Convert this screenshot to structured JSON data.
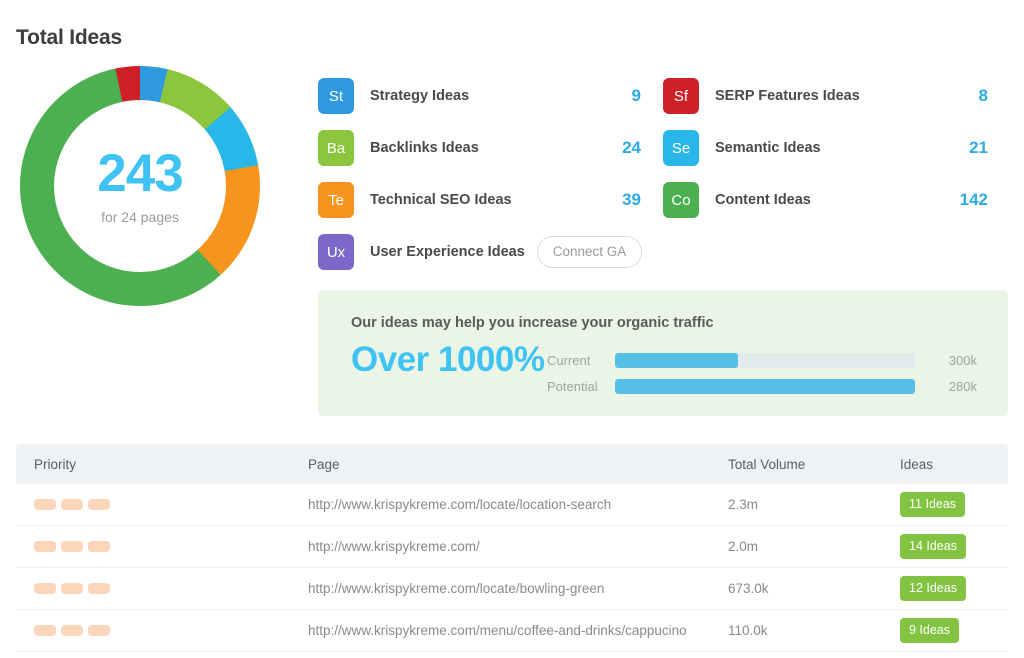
{
  "page_title": "Total Ideas",
  "donut": {
    "total": "243",
    "subtitle": "for 24 pages"
  },
  "chart_data": {
    "type": "pie",
    "title": "Total Ideas",
    "center_value": 243,
    "center_label": "for 24 pages",
    "categories": [
      "Strategy Ideas",
      "Backlinks Ideas",
      "Semantic Ideas",
      "Technical SEO Ideas",
      "Content Ideas",
      "SERP Features Ideas"
    ],
    "values": [
      9,
      24,
      21,
      39,
      142,
      8
    ],
    "colors": [
      "#2f9ae0",
      "#8cc63e",
      "#29b6e8",
      "#f7941e",
      "#4caf50",
      "#d02027"
    ],
    "total": 243,
    "legend_position": "right",
    "grid": false
  },
  "legend": {
    "left_column": [
      {
        "abbr": "St",
        "color": "#2f9ae0",
        "label": "Strategy Ideas",
        "value": "9",
        "action": null
      },
      {
        "abbr": "Ba",
        "color": "#8cc63e",
        "label": "Backlinks Ideas",
        "value": "24",
        "action": null
      },
      {
        "abbr": "Te",
        "color": "#f7941e",
        "label": "Technical SEO Ideas",
        "value": "39",
        "action": null
      },
      {
        "abbr": "Ux",
        "color": "#7b68c8",
        "label": "User Experience Ideas",
        "value": null,
        "action": "Connect GA"
      }
    ],
    "right_column": [
      {
        "abbr": "Sf",
        "color": "#d02027",
        "label": "SERP Features Ideas",
        "value": "8",
        "action": null
      },
      {
        "abbr": "Se",
        "color": "#29b6e8",
        "label": "Semantic Ideas",
        "value": "21",
        "action": null
      },
      {
        "abbr": "Co",
        "color": "#4caf50",
        "label": "Content Ideas",
        "value": "142",
        "action": null
      }
    ]
  },
  "promo": {
    "headline": "Our ideas may help you increase your organic traffic",
    "big_number": "Over 1000%",
    "bars": [
      {
        "label": "Current",
        "value": "300k",
        "fill_percent": 41
      },
      {
        "label": "Potential",
        "value": "280k",
        "fill_percent": 100
      }
    ]
  },
  "table": {
    "headers": {
      "priority": "Priority",
      "page": "Page",
      "volume": "Total Volume",
      "ideas": "Ideas"
    },
    "rows": [
      {
        "priority_blocks": 3,
        "page": "http://www.krispykreme.com/locate/location-search",
        "volume": "2.3m",
        "ideas": "11 Ideas"
      },
      {
        "priority_blocks": 3,
        "page": "http://www.krispykreme.com/",
        "volume": "2.0m",
        "ideas": "14 Ideas"
      },
      {
        "priority_blocks": 3,
        "page": "http://www.krispykreme.com/locate/bowling-green",
        "volume": "673.0k",
        "ideas": "12 Ideas"
      },
      {
        "priority_blocks": 3,
        "page": "http://www.krispykreme.com/menu/coffee-and-drinks/cappucino",
        "volume": "110.0k",
        "ideas": "9 Ideas"
      }
    ]
  }
}
